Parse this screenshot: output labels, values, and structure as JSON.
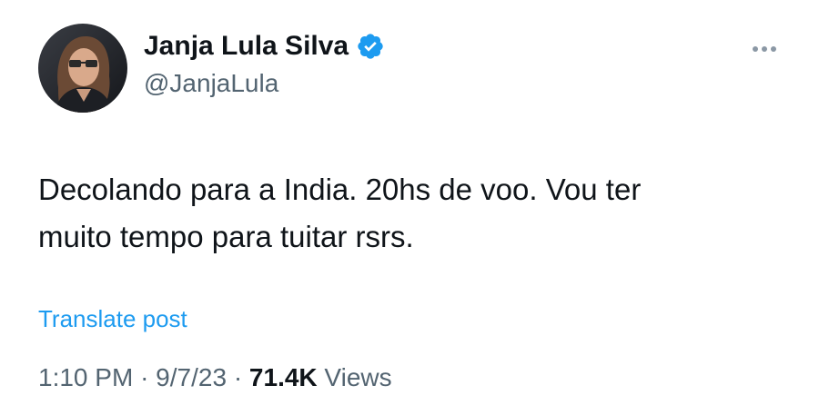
{
  "author": {
    "display_name": "Janja Lula Silva",
    "handle": "@JanjaLula",
    "verified": true,
    "avatar_icon": "profile-photo"
  },
  "post": {
    "text_line1": "Decolando para a India. 20hs de voo. Vou ter",
    "text_line2": "muito tempo para tuitar rsrs."
  },
  "actions": {
    "translate_label": "Translate post",
    "more_icon": "more-options-icon"
  },
  "meta": {
    "time": "1:10 PM",
    "separator": "·",
    "date": "9/7/23",
    "views_count": "71.4K",
    "views_label": "Views"
  },
  "colors": {
    "accent": "#1d9bf0",
    "text_primary": "#0f1419",
    "text_secondary": "#536471"
  }
}
